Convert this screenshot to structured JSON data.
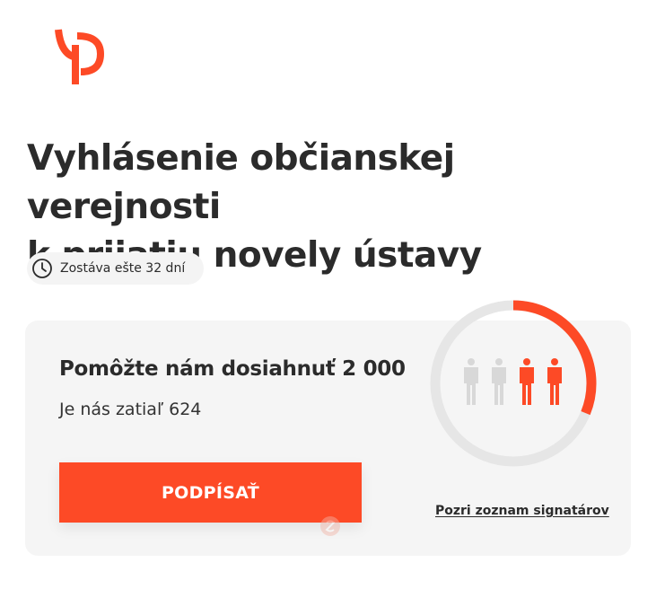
{
  "brand": {
    "logo_icon": "stylized-p-logo-icon",
    "accent_color": "#fd4a26"
  },
  "petition": {
    "title_line1": "Vyhlásenie občianskej verejnosti",
    "title_line2": "k prijatiu novely ústavy"
  },
  "countdown": {
    "icon": "clock-icon",
    "text": "Zostáva ešte 32 dní"
  },
  "progress": {
    "goal_text": "Pomôžte nám dosiahnuť 2 000",
    "count_text": "Je nás zatiaľ 624",
    "signed": 624,
    "goal": 2000,
    "ring_track_color": "#e6e6e6",
    "people_icon": "person-icon",
    "people_active_color": "#fd4a26",
    "people_inactive_color": "#d8d8d8"
  },
  "actions": {
    "sign_label": "PODPÍSAŤ",
    "signers_link": "Pozri zoznam signatárov"
  }
}
